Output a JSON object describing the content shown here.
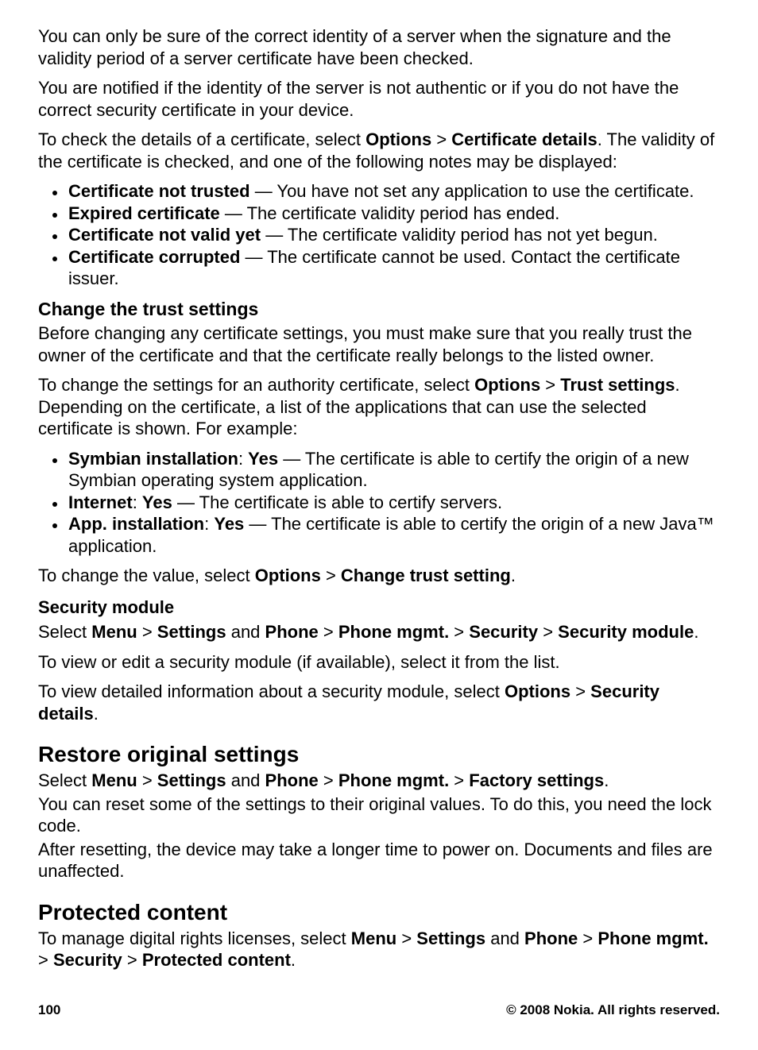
{
  "para1": "You can only be sure of the correct identity of a server when the signature and the validity period of a server certificate have been checked.",
  "para2": "You are notified if the identity of the server is not authentic or if you do not have the correct security certificate in your device.",
  "para3_pre": "To check the details of a certificate, select ",
  "para3_b1": "Options",
  "sep_gt": " > ",
  "para3_b2": "Certificate details",
  "para3_post": ". The validity of the certificate is checked, and one of the following notes may be displayed:",
  "list1": {
    "i0": {
      "b": "Certificate not trusted",
      "t": "  — You have not set any application to use the certificate."
    },
    "i1": {
      "b": "Expired certificate",
      "t": "  — The certificate validity period has ended."
    },
    "i2": {
      "b": "Certificate not valid yet",
      "t": "  — The certificate validity period has not yet begun."
    },
    "i3": {
      "b": "Certificate corrupted",
      "t": "  — The certificate cannot be used. Contact the certificate issuer."
    }
  },
  "h_trust": "Change the trust settings",
  "para4": "Before changing any certificate settings, you must make sure that you really trust the owner of the certificate and that the certificate really belongs to the listed owner.",
  "para5_pre": "To change the settings for an authority certificate, select ",
  "para5_b1": "Options",
  "para5_b2": "Trust settings",
  "para5_post": ". Depending on the certificate, a list of the applications that can use the selected certificate is shown. For example:",
  "list2": {
    "i0": {
      "b1": "Symbian installation",
      "colon": ": ",
      "b2": "Yes",
      "t": " — The certificate is able to certify the origin of a new Symbian operating system application."
    },
    "i1": {
      "b1": "Internet",
      "colon": ": ",
      "b2": "Yes",
      "t": " — The certificate is able to certify servers."
    },
    "i2": {
      "b1": "App. installation",
      "colon": ": ",
      "b2": "Yes",
      "t": " — The certificate is able to certify the origin of a new Java™ application."
    }
  },
  "para6_pre": "To change the value, select ",
  "para6_b1": "Options",
  "para6_b2": "Change trust setting",
  "period": ".",
  "h_secmod": "Security module",
  "para7_pre": "Select ",
  "b_menu": "Menu",
  "b_settings": "Settings",
  "and_sp": " and ",
  "b_phone": "Phone",
  "b_phonemgmt": "Phone mgmt.",
  "b_security": "Security",
  "b_secmod": "Security module",
  "para8": "To view or edit a security module (if available), select it from the list.",
  "para9_pre": "To view detailed information about a security module, select ",
  "para9_b1": "Options",
  "para9_b2": "Security details",
  "h_restore": "Restore original settings",
  "b_factory": "Factory settings",
  "para11": "You can reset some of the settings to their original values. To do this, you need the lock code.",
  "para12": "After resetting, the device may take a longer time to power on. Documents and files are unaffected.",
  "h_protected": "Protected content",
  "para13_pre": "To manage digital rights licenses, select ",
  "b_protcontent": "Protected content",
  "footer_pg": "100",
  "footer_copy": "© 2008 Nokia. All rights reserved."
}
